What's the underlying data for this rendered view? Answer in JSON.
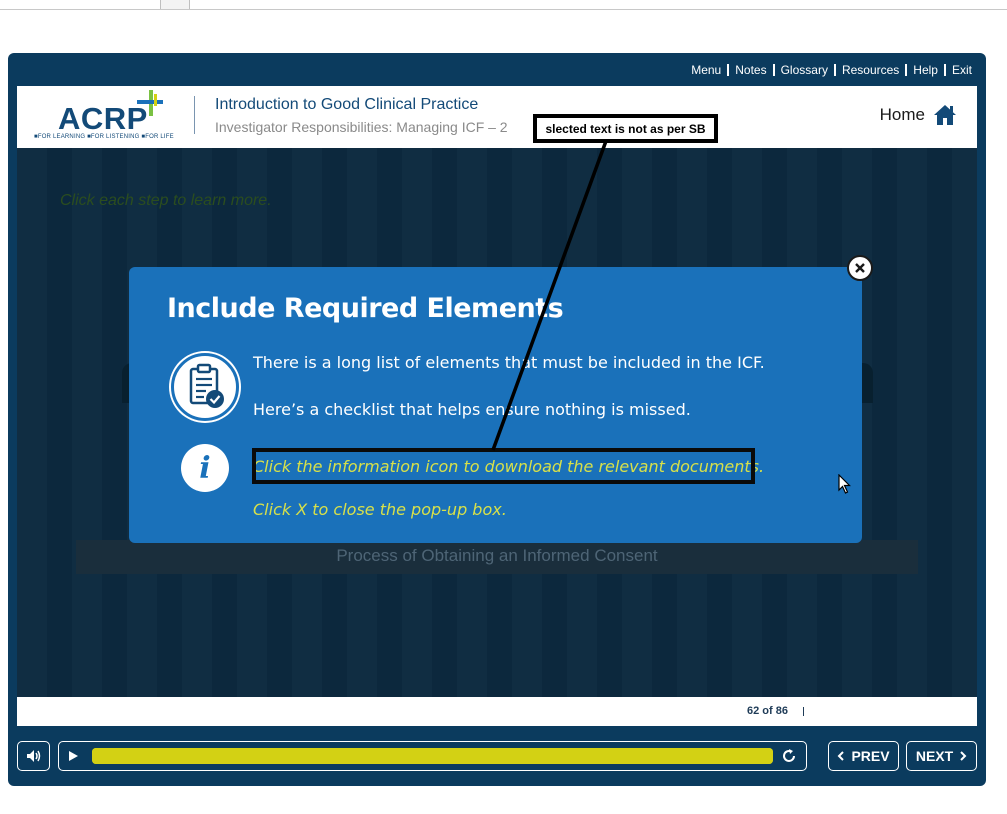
{
  "topnav": {
    "items": [
      "Menu",
      "Notes",
      "Glossary",
      "Resources",
      "Help",
      "Exit"
    ]
  },
  "header": {
    "logo_text": "ACRP",
    "logo_tagline": "■FOR LEARNING ■FOR LISTENING ■FOR LIFE",
    "course_title": "Introduction to Good Clinical Practice",
    "course_subtitle": "Investigator Responsibilities: Managing ICF – 2",
    "home_label": "Home",
    "home_icon": "home-icon"
  },
  "stage": {
    "instruction": "Click each step to learn more.",
    "process_label": "Process of Obtaining an Informed Consent"
  },
  "popup": {
    "title": "Include Required Elements",
    "line1": "There is a long list of elements that must be included in the ICF.",
    "line2": "Here’s a checklist that helps ensure nothing is missed.",
    "hint_download": "Click the information icon to download the relevant documents.",
    "hint_close": "Click X to close the pop-up box.",
    "info_glyph": "i",
    "icons": [
      "clipboard-check-icon",
      "info-icon",
      "close-icon"
    ]
  },
  "annotation": {
    "callout_text": "slected text is not as per SB"
  },
  "footer": {
    "slide_count": "62 of 86"
  },
  "controls": {
    "progress": 1.0,
    "prev_label": "PREV",
    "next_label": "NEXT"
  },
  "colors": {
    "player_frame": "#0b3b5e",
    "popup_bg": "#1a71ba",
    "hint_text": "#d7e04a",
    "progress": "#d3d114"
  }
}
